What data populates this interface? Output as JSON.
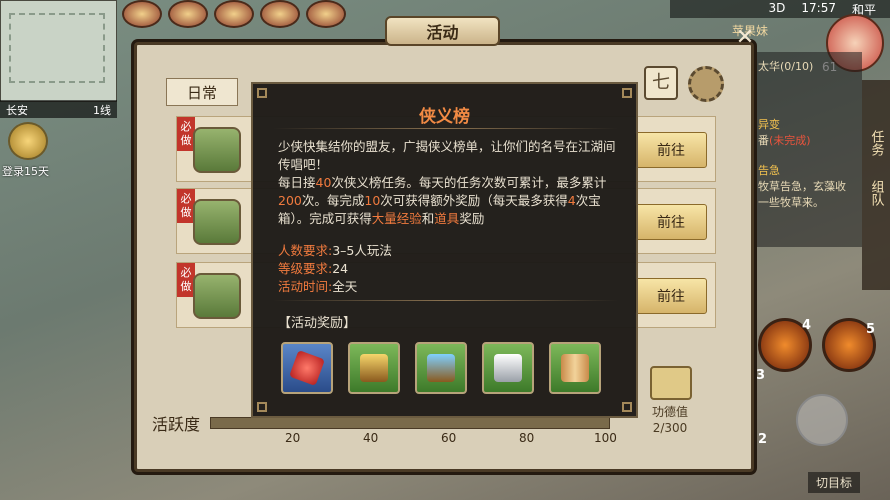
{
  "status": {
    "network": "3D",
    "time": "17:57",
    "location": "和平"
  },
  "minimap": {
    "city": "长安",
    "line": "1线"
  },
  "login": {
    "label": "登录15天"
  },
  "top_right": {
    "name": "苹果妹",
    "level": "61"
  },
  "quest_panel": {
    "header": "太华(0/10)",
    "title1": "异变",
    "line1": "番",
    "line1_red": "(未完成)",
    "title2": "告急",
    "text2": "牧草告急，玄藻收一些牧草来。"
  },
  "side_tabs": [
    "任务",
    "组队"
  ],
  "skills": [
    {
      "count": "4"
    },
    {
      "count": "5"
    },
    {
      "count": "3"
    },
    {
      "count": "2"
    }
  ],
  "target": {
    "label": "切目标"
  },
  "window": {
    "title": "活动",
    "tab_daily": "日常",
    "rows": [
      {
        "badge": "必做",
        "go": "前往"
      },
      {
        "badge": "必做",
        "go": "前往"
      },
      {
        "badge": "必做",
        "go": "前往"
      }
    ],
    "merit_label": "功德值",
    "merit_value": "2/300",
    "activity_label": "活跃度",
    "progress": 0.0,
    "ticks": [
      "20",
      "40",
      "60",
      "80",
      "100"
    ]
  },
  "modal": {
    "title": "侠义榜",
    "desc1": "少侠快集结你的盟友，广揭侠义榜单，让你们的名号在江湖间传唱吧！",
    "desc2a": "每日接",
    "desc2b": "40",
    "desc2c": "次侠义榜任务。每天的任务次数可累计，最多累计",
    "desc2d": "200",
    "desc2e": "次。每完成",
    "desc2f": "10",
    "desc2g": "次可获得额外奖励（每天最多获得",
    "desc2h": "4",
    "desc2i": "次宝箱）。完成可获得",
    "desc2j": "大量经验",
    "desc2k": "和",
    "desc2l": "道具",
    "desc2m": "奖励",
    "req_people_k": "人数要求:",
    "req_people_v": "3–5人玩法",
    "req_level_k": "等级要求:",
    "req_level_v": "24",
    "req_time_k": "活动时间:",
    "req_time_v": "全天",
    "reward_title": "【活动奖励】",
    "rewards": [
      "red-gem-icon",
      "gold-chest-icon",
      "blue-chest-icon",
      "silver-ingot-icon",
      "scroll-icon"
    ]
  }
}
